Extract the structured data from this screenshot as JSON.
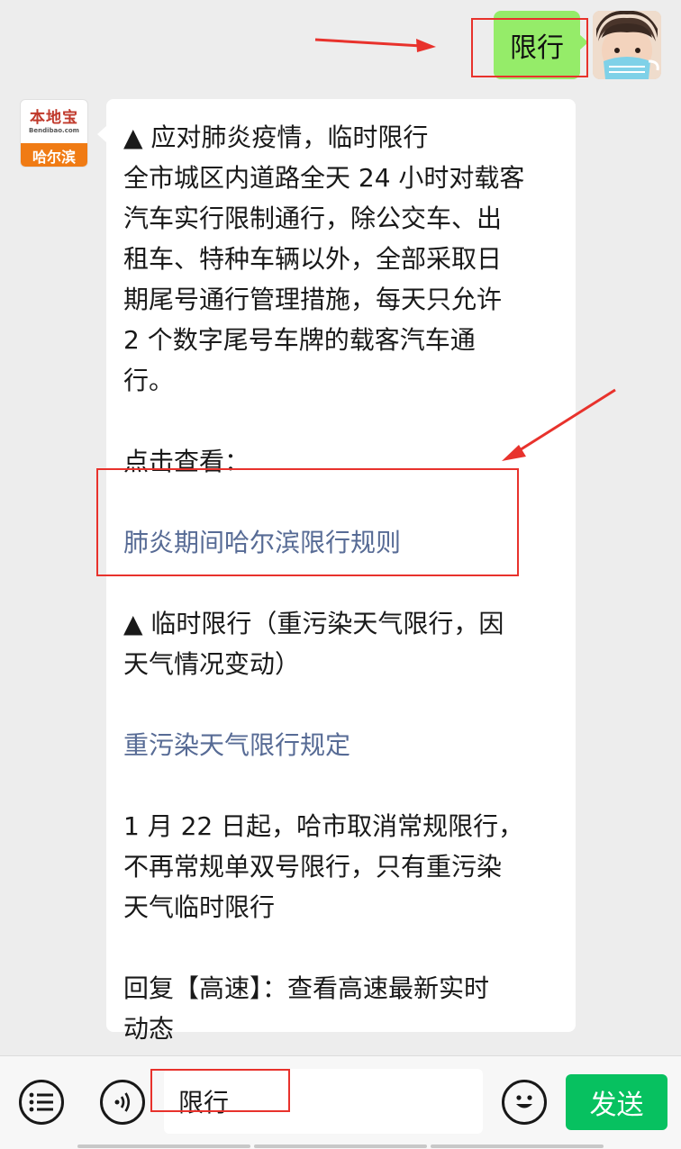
{
  "outgoing": {
    "text": "限行"
  },
  "bot": {
    "logo_name": "本地宝",
    "logo_domain": "Bendibao.com",
    "logo_city": "哈尔滨"
  },
  "incoming": {
    "line1": "▲ 应对肺炎疫情，临时限行",
    "para1": "全市城区内道路全天 24 小时对载客\n汽车实行限制通行，除公交车、出\n租车、特种车辆以外，全部采取日\n期尾号通行管理措施，每天只允许\n2 个数字尾号车牌的载客汽车通\n行。",
    "see_label": "点击查看：",
    "link1": "肺炎期间哈尔滨限行规则",
    "temp_heading": "▲ 临时限行（重污染天气限行，因\n天气情况变动）",
    "link2": "重污染天气限行规定",
    "para2": "1 月 22 日起，哈市取消常规限行，\n不再常规单双号限行，只有重污染\n天气临时限行",
    "reply": "回复【高速】：查看高速最新实时\n动态"
  },
  "input_bar": {
    "input_value": "限行",
    "send_label": "发送"
  },
  "colors": {
    "annotation_red": "#e8322c",
    "send_green": "#07c160",
    "bubble_green": "#95ec69",
    "link_blue": "#576b95"
  }
}
